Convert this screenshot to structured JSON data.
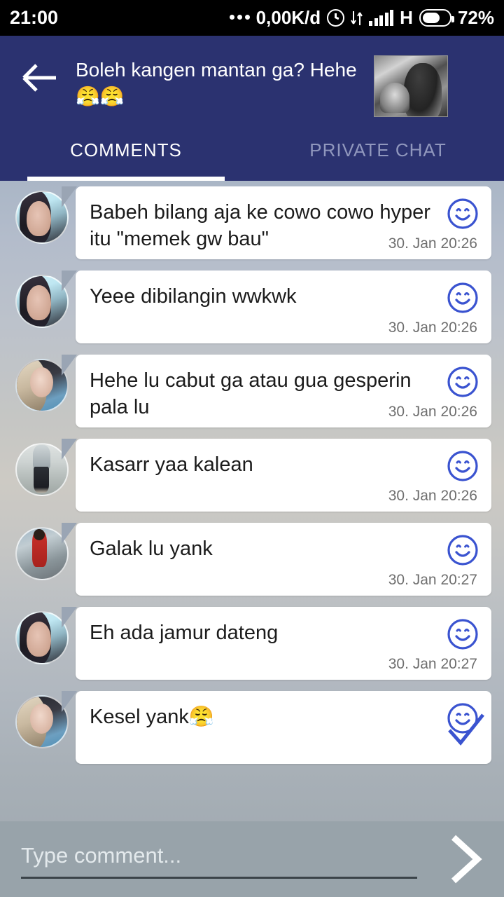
{
  "status_bar": {
    "time": "21:00",
    "data_rate": "0,00K/d",
    "network_type": "H",
    "battery_percent": "72%",
    "icons": [
      "more-dots-icon",
      "alarm-clock-icon",
      "data-transfer-icon",
      "signal-bars-icon",
      "battery-icon"
    ]
  },
  "header": {
    "back_icon": "back-arrow-icon",
    "title": "Boleh kangen mantan ga? Hehe😤😤",
    "thumbnail_alt": "room-thumbnail",
    "background_color": "#2b3270"
  },
  "tabs": [
    {
      "label": "COMMENTS",
      "active": true
    },
    {
      "label": "PRIVATE CHAT",
      "active": false
    }
  ],
  "messages": [
    {
      "avatar": "av-a",
      "text": "Babeh bilang aja ke cowo cowo hyper itu \"memek gw bau\"",
      "time": "30. Jan 20:26",
      "reaction_icon": "smiley-icon",
      "checked": false
    },
    {
      "avatar": "av-a",
      "text": "Yeee dibilangin wwkwk",
      "time": "30. Jan 20:26",
      "reaction_icon": "smiley-icon",
      "checked": false
    },
    {
      "avatar": "av-b",
      "text": "Hehe lu cabut ga atau gua gesperin pala lu",
      "time": "30. Jan 20:26",
      "reaction_icon": "smiley-icon",
      "checked": false
    },
    {
      "avatar": "av-c",
      "text": "Kasarr yaa kalean",
      "time": "30. Jan 20:26",
      "reaction_icon": "smiley-icon",
      "checked": false
    },
    {
      "avatar": "av-d",
      "text": "Galak lu yank",
      "time": "30. Jan 20:27",
      "reaction_icon": "smiley-icon",
      "checked": false
    },
    {
      "avatar": "av-a",
      "text": "Eh ada jamur dateng",
      "time": "30. Jan 20:27",
      "reaction_icon": "smiley-icon",
      "checked": false
    },
    {
      "avatar": "av-b",
      "text": "Kesel yank😤",
      "time": "",
      "reaction_icon": "smiley-icon",
      "checked": true
    }
  ],
  "composer": {
    "value": "",
    "placeholder": "Type comment...",
    "send_icon": "send-chevron-icon"
  },
  "colors": {
    "header": "#2b3270",
    "accent_blue": "#3a53d0",
    "bubble": "#ffffff",
    "input_bar": "#98a3aa"
  }
}
